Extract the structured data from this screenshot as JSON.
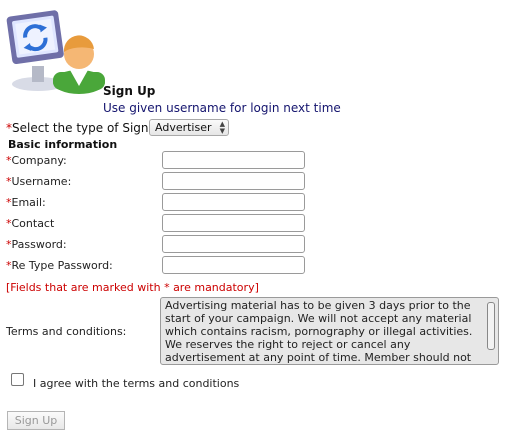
{
  "header": {
    "title": "Sign Up",
    "subtitle": "Use given username for login next time"
  },
  "signup_type": {
    "asterisk": "*",
    "label": "Select the type of Signup:",
    "selected": "Advertiser"
  },
  "section_title": "Basic information",
  "fields": [
    {
      "asterisk": "*",
      "label": "Company:"
    },
    {
      "asterisk": "*",
      "label": "Username:"
    },
    {
      "asterisk": "*",
      "label": "Email:"
    },
    {
      "asterisk": "*",
      "label": "Contact"
    },
    {
      "asterisk": "*",
      "label": "Password:"
    },
    {
      "asterisk": "*",
      "label": "Re Type Password:"
    }
  ],
  "mandatory_note": "[Fields that are marked with * are mandatory]",
  "terms": {
    "label": "Terms and conditions:",
    "text": "Advertising material has to be given 3 days prior to the start of your campaign. We will not accept any material which contains racism, pornography or illegal activities. We reserves the right to reject or cancel any advertisement at any point of time. Member should not disclose the account password to anyone else and"
  },
  "agree_label": "I agree with the terms and conditions",
  "submit_label": "Sign Up",
  "colors": {
    "required": "#cc0000",
    "subtitle": "#14146e"
  }
}
